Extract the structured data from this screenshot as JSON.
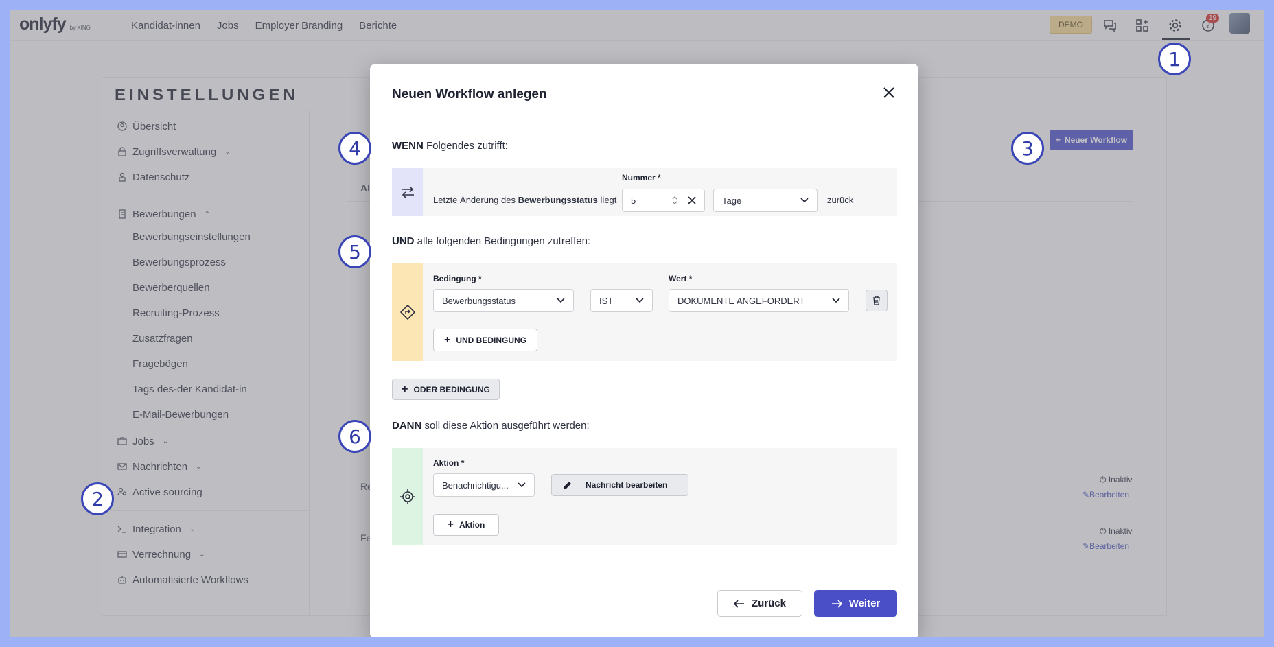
{
  "topbar": {
    "logo": "onlyfy",
    "logo_sub": "by XING",
    "nav": [
      "Kandidat-innen",
      "Jobs",
      "Employer Branding",
      "Berichte"
    ],
    "demo": "DEMO",
    "notification_count": "19"
  },
  "settings": {
    "title": "EINSTELLUNGEN",
    "sidebar": {
      "overview": "Übersicht",
      "access": "Zugriffsverwaltung",
      "privacy": "Datenschutz",
      "applications": "Bewerbungen",
      "application_subitems": [
        "Bewerbungseinstellungen",
        "Bewerbungsprozess",
        "Bewerberquellen",
        "Recruiting-Prozess",
        "Zusatzfragen",
        "Fragebögen",
        "Tags des-der Kandidat-in",
        "E-Mail-Bewerbungen"
      ],
      "jobs": "Jobs",
      "messages": "Nachrichten",
      "active_sourcing": "Active sourcing",
      "integration": "Integration",
      "billing": "Verrechnung",
      "workflows": "Automatisierte Workflows"
    },
    "new_workflow_button": "Neuer Workflow",
    "background": {
      "table_header_fragment": "Al",
      "row1_fragment": "Re",
      "row2_fragment": "Fe",
      "status_inactive": "Inaktiv",
      "edit_link": "Bearbeiten"
    }
  },
  "modal": {
    "title": "Neuen Workflow anlegen",
    "when": {
      "keyword": "WENN",
      "text": "Folgendes zutrifft:"
    },
    "trigger": {
      "prefix": "Letzte Änderung des",
      "bold": "Bewerbungsstatus",
      "suffix": "liegt",
      "number_label": "Nummer",
      "number_value": "5",
      "unit": "Tage",
      "after": "zurück"
    },
    "and": {
      "keyword": "UND",
      "text": "alle folgenden Bedingungen zutreffen:"
    },
    "condition": {
      "condition_label": "Bedingung",
      "condition_value": "Bewerbungsstatus",
      "operator_value": "IST",
      "value_label": "Wert",
      "value_value": "DOKUMENTE ANGEFORDERT",
      "add_and": "UND BEDINGUNG"
    },
    "add_or": "ODER BEDINGUNG",
    "then": {
      "keyword": "DANN",
      "text": "soll diese Aktion ausgeführt werden:"
    },
    "action": {
      "label": "Aktion",
      "value": "Benachrichtigu...",
      "edit_message": "Nachricht bearbeiten",
      "add_action": "Aktion"
    },
    "required_mark": "*",
    "back": "Zurück",
    "next": "Weiter"
  },
  "callouts": [
    "1",
    "2",
    "3",
    "4",
    "5",
    "6"
  ],
  "colors": {
    "accent": "#4a4fc7",
    "trigger_strip": "#e3e4fa",
    "condition_strip": "#fbe6b4",
    "action_strip": "#def4e3",
    "callout_border": "#3a45b8",
    "frame_bg": "#9db2f6"
  }
}
